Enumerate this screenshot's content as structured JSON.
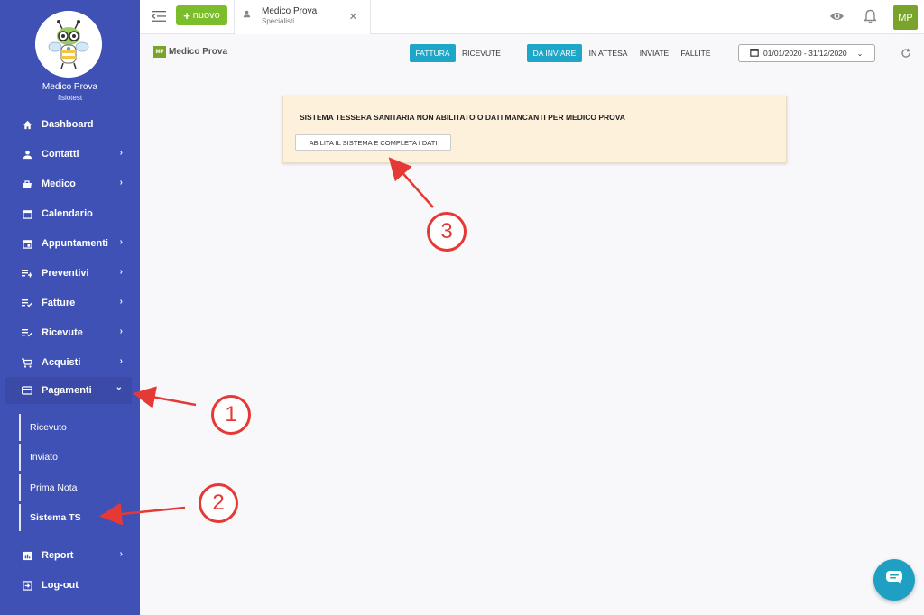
{
  "user": {
    "name": "Medico Prova",
    "subtitle": "fisiotest"
  },
  "sidebar": {
    "items": [
      {
        "label": "Dashboard",
        "icon": "home-icon",
        "chevron": false
      },
      {
        "label": "Contatti",
        "icon": "person-icon",
        "chevron": true
      },
      {
        "label": "Medico",
        "icon": "medical-bag-icon",
        "chevron": true
      },
      {
        "label": "Calendario",
        "icon": "calendar-icon",
        "chevron": false
      },
      {
        "label": "Appuntamenti",
        "icon": "calendar-event-icon",
        "chevron": true
      },
      {
        "label": "Preventivi",
        "icon": "list-add-icon",
        "chevron": true
      },
      {
        "label": "Fatture",
        "icon": "list-check-icon",
        "chevron": true
      },
      {
        "label": "Ricevute",
        "icon": "list-check-icon",
        "chevron": true
      },
      {
        "label": "Acquisti",
        "icon": "cart-icon",
        "chevron": true
      },
      {
        "label": "Pagamenti",
        "icon": "credit-card-icon",
        "chevron": true,
        "expanded": true
      },
      {
        "label": "Report",
        "icon": "chart-icon",
        "chevron": true
      },
      {
        "label": "Log-out",
        "icon": "logout-icon",
        "chevron": false
      }
    ],
    "subitems": [
      {
        "label": "Ricevuto"
      },
      {
        "label": "Inviato"
      },
      {
        "label": "Prima Nota"
      },
      {
        "label": "Sistema TS",
        "selected": true
      }
    ]
  },
  "topbar": {
    "new_label": "nuovo",
    "tab": {
      "title": "Medico Prova",
      "subtitle": "Specialisti"
    },
    "avatar_initials": "MP"
  },
  "subheader": {
    "brand_badge": "MP",
    "brand_name": "Medico Prova",
    "doc_toggle": [
      "FATTURA",
      "RICEVUTE"
    ],
    "status_toggle": [
      "DA INVIARE",
      "IN ATTESA",
      "INVIATE",
      "FALLITE"
    ],
    "date_range": "01/01/2020 - 31/12/2020"
  },
  "alert": {
    "message": "SISTEMA TESSERA SANITARIA NON ABILITATO O DATI MANCANTI PER MEDICO PROVA",
    "button_label": "ABILITA IL SISTEMA E COMPLETA I DATI"
  },
  "annotations": [
    "1",
    "2",
    "3"
  ],
  "colors": {
    "sidebar": "#3f51b5",
    "primary_toggle": "#1da6c8",
    "new_button": "#7cbd2c",
    "avatar": "#7aa32c",
    "alert_bg": "#fdf1db",
    "annotation": "#e53935"
  }
}
